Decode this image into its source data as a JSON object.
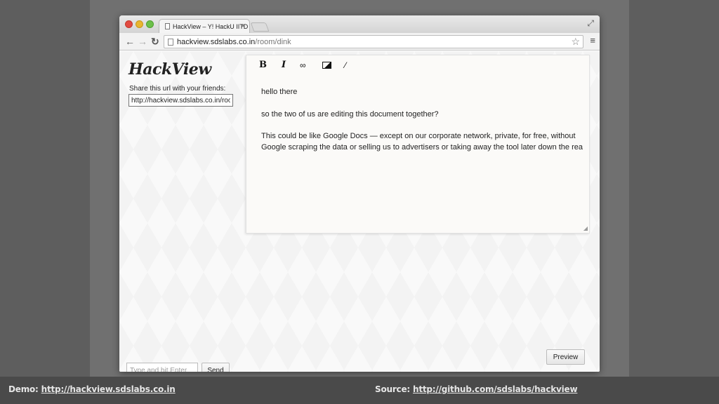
{
  "browser": {
    "tab_title": "HackView – Y! HackU IITD",
    "tab_close": "×",
    "url_host": "hackview.sdslabs.co.in",
    "url_path": "/room/dink",
    "back_icon": "←",
    "forward_icon": "→",
    "reload_icon": "↻",
    "star_icon": "☆",
    "menu_icon": "≡",
    "fullscreen_icon": "⤢"
  },
  "app": {
    "logo": "HackView",
    "share_label": "Share this url with your friends:",
    "share_url": "http://hackview.sdslabs.co.in/room/dink"
  },
  "editor": {
    "tools": {
      "bold": "B",
      "italic": "I",
      "link": "∞",
      "clear": "⁄"
    },
    "lines": [
      "hello there",
      "so the two of us are editing this document together?",
      "This could be like Google Docs — except on our corporate network, private, for free, without Google scraping the data or selling us to advertisers or taking away the tool later down the rea"
    ]
  },
  "chat": {
    "placeholder": "Type and hit Enter",
    "send_label": "Send"
  },
  "preview_label": "Preview",
  "captions": {
    "demo_label": "Demo:",
    "demo_link": "http://hackview.sdslabs.co.in",
    "source_label": "Source:",
    "source_link": "http://github.com/sdslabs/hackview"
  }
}
